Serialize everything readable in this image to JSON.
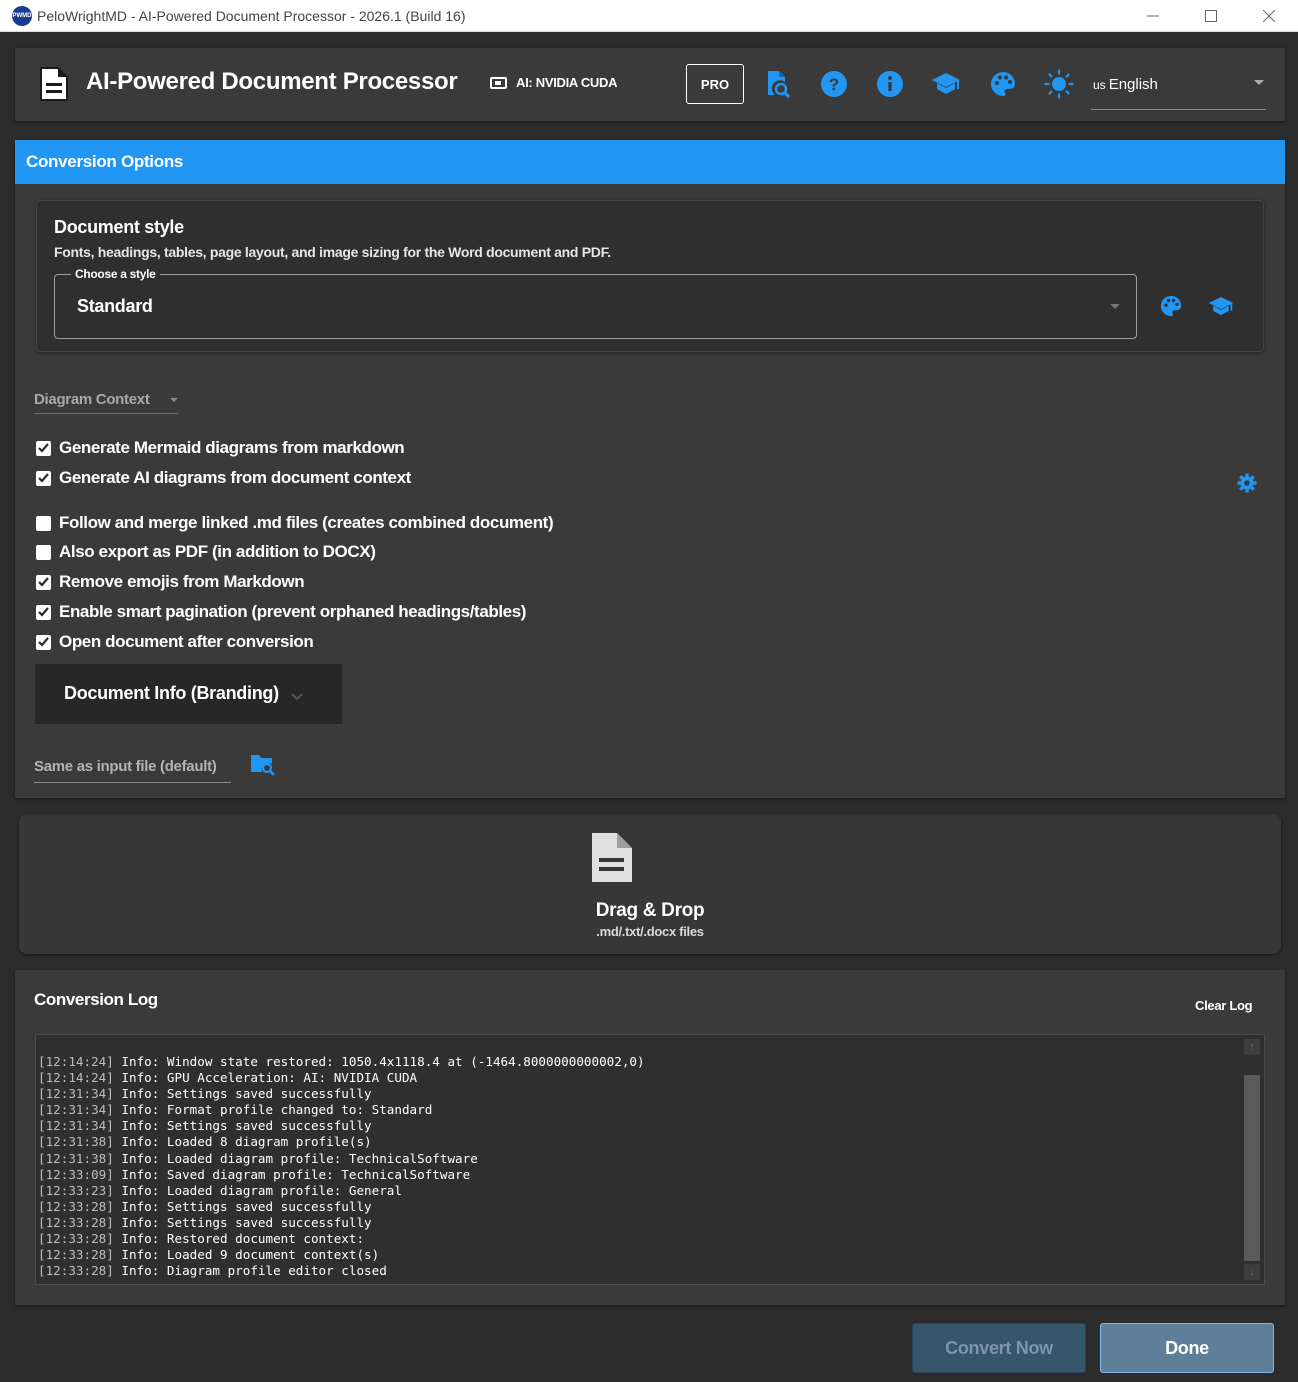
{
  "window": {
    "title": "PeloWrightMD - AI-Powered Document Processor - 2026.1 (Build 16)",
    "logo_text": "PWMD",
    "controls": [
      "minimize",
      "maximize",
      "close"
    ]
  },
  "header": {
    "app_title": "AI-Powered Document Processor",
    "gpu_label": "AI: NVIDIA CUDA",
    "pro_label": "PRO",
    "icons": [
      "file-search-icon",
      "help-icon",
      "info-icon",
      "school-icon",
      "palette-icon",
      "theme-sun-icon"
    ],
    "language": {
      "flag": "US",
      "label": "English"
    },
    "accent_color": "#2196f3"
  },
  "options": {
    "panel_title": "Conversion Options",
    "style_card": {
      "title": "Document style",
      "description": "Fonts, headings, tables, page layout, and image sizing for the Word document and PDF.",
      "select_label": "Choose a style",
      "select_value": "Standard"
    },
    "diagram_context_label": "Diagram Context",
    "checkboxes": [
      {
        "label": "Generate Mermaid diagrams from markdown",
        "checked": true
      },
      {
        "label": "Generate AI diagrams from document context",
        "checked": true
      },
      {
        "label": "Follow and merge linked .md files (creates combined document)",
        "checked": false
      },
      {
        "label": "Also export as PDF (in addition to DOCX)",
        "checked": false
      },
      {
        "label": "Remove emojis from Markdown",
        "checked": true
      },
      {
        "label": "Enable smart pagination (prevent orphaned headings/tables)",
        "checked": true
      },
      {
        "label": "Open document after conversion",
        "checked": true
      }
    ],
    "doc_info_label": "Document Info (Branding)",
    "output_folder_placeholder": "Same as input file (default)"
  },
  "dropzone": {
    "title": "Drag & Drop",
    "subtitle": ".md/.txt/.docx files"
  },
  "log": {
    "title": "Conversion Log",
    "clear_label": "Clear Log",
    "lines": [
      {
        "ts": "[12:14:24]",
        "msg": "Info: Window state restored: 1050.4x1118.4 at (-1464.8000000000002,0)"
      },
      {
        "ts": "[12:14:24]",
        "msg": "Info: GPU Acceleration: AI: NVIDIA CUDA"
      },
      {
        "ts": "[12:31:34]",
        "msg": "Info: Settings saved successfully"
      },
      {
        "ts": "[12:31:34]",
        "msg": "Info: Format profile changed to: Standard"
      },
      {
        "ts": "[12:31:34]",
        "msg": "Info: Settings saved successfully"
      },
      {
        "ts": "[12:31:38]",
        "msg": "Info: Loaded 8 diagram profile(s)"
      },
      {
        "ts": "[12:31:38]",
        "msg": "Info: Loaded diagram profile: TechnicalSoftware"
      },
      {
        "ts": "[12:33:09]",
        "msg": "Info: Saved diagram profile: TechnicalSoftware"
      },
      {
        "ts": "[12:33:23]",
        "msg": "Info: Loaded diagram profile: General"
      },
      {
        "ts": "[12:33:28]",
        "msg": "Info: Settings saved successfully"
      },
      {
        "ts": "[12:33:28]",
        "msg": "Info: Settings saved successfully"
      },
      {
        "ts": "[12:33:28]",
        "msg": "Info: Restored document context:"
      },
      {
        "ts": "[12:33:28]",
        "msg": "Info: Loaded 9 document context(s)"
      },
      {
        "ts": "[12:33:28]",
        "msg": "Info: Diagram profile editor closed"
      }
    ]
  },
  "actions": {
    "convert_label": "Convert Now",
    "done_label": "Done"
  }
}
